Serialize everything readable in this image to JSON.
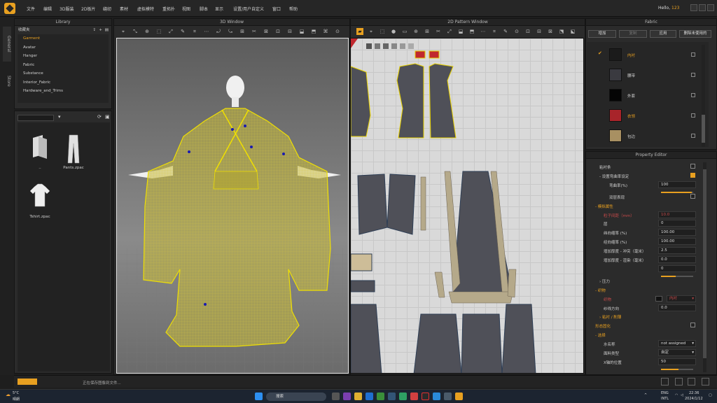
{
  "menu": [
    "文件",
    "编辑",
    "3D服装",
    "2D板片",
    "缝纫",
    "素材",
    "虚拟模特",
    "重拓扑",
    "视图",
    "脚本",
    "显示",
    "设置/用户自定义",
    "窗口",
    "帮助"
  ],
  "greeting": {
    "prefix": "Hello, ",
    "user": "123"
  },
  "side_tabs": [
    "General",
    "Store"
  ],
  "library": {
    "title": "Library",
    "favorites_label": "收藏夹",
    "items": [
      "Garment",
      "Avatar",
      "Hanger",
      "Fabric",
      "Substance",
      "Interior_Fabric",
      "Hardware_and_Trims"
    ],
    "selected_index": 0,
    "files": [
      {
        "label": ".."
      },
      {
        "label": "Pants.zpac"
      },
      {
        "label": "Tshirt.zpac"
      }
    ]
  },
  "window_3d": {
    "title": "3D Window"
  },
  "window_2d": {
    "title": "2D Pattern Window"
  },
  "fabric": {
    "title": "Fabric",
    "buttons": [
      "增加",
      "复制",
      "应用",
      "删除未使用的"
    ],
    "items": [
      {
        "name": "内衬",
        "color": "#1b1b1b",
        "highlight": true,
        "checked": true
      },
      {
        "name": "腰带",
        "color": "#3a3a40",
        "highlight": false,
        "checked": false
      },
      {
        "name": "外套",
        "color": "#050505",
        "highlight": false,
        "checked": false
      },
      {
        "name": "衣领",
        "color": "#a8242a",
        "highlight": true,
        "checked": false
      },
      {
        "name": "包边",
        "color": "#a89062",
        "highlight": false,
        "checked": false
      }
    ]
  },
  "property": {
    "title": "Property Editor",
    "rows": [
      {
        "label": "粘衬条",
        "type": "check",
        "checked": false,
        "indent": 8
      },
      {
        "label": "- 设置弯曲率设定",
        "type": "check",
        "checked": true,
        "indent": 8
      },
      {
        "label": "弯曲率(%)",
        "type": "value",
        "value": "100",
        "indent": 22,
        "slider": 0.95
      },
      {
        "label": "双层表现",
        "type": "check",
        "checked": false,
        "indent": 22
      },
      {
        "label": "- 模拟属性",
        "type": "section",
        "indent": 2
      },
      {
        "label": "粒子间距（mm）",
        "type": "value",
        "value": "10.0",
        "indent": 14,
        "style": "red",
        "valstyle": "red"
      },
      {
        "label": "层",
        "type": "value",
        "value": "0",
        "indent": 14
      },
      {
        "label": "纬向缩率 (%)",
        "type": "value",
        "value": "100.00",
        "indent": 14
      },
      {
        "label": "经向缩率 (%)",
        "type": "value",
        "value": "100.00",
        "indent": 14
      },
      {
        "label": "增加厚度 - 冲突（毫米）",
        "type": "value",
        "value": "2.5",
        "indent": 14
      },
      {
        "label": "增加厚度 - 渲染（毫米）",
        "type": "value",
        "value": "0.0",
        "indent": 14
      },
      {
        "label": "",
        "type": "value",
        "value": "0",
        "indent": 14,
        "slider": 0.45
      },
      {
        "label": "› 压力",
        "type": "plain",
        "indent": 8
      },
      {
        "label": "- 织物",
        "type": "section",
        "indent": 2
      },
      {
        "label": "织物",
        "type": "fabric",
        "value": "内衬",
        "indent": 14,
        "style": "red"
      },
      {
        "label": "纱线方向",
        "type": "value",
        "value": "0.0",
        "indent": 14
      },
      {
        "label": "› 粘衬 / 削薄",
        "type": "section",
        "indent": 8
      },
      {
        "label": "形态固化",
        "type": "check",
        "checked": false,
        "indent": 2,
        "style": "or"
      },
      {
        "label": "- 选择",
        "type": "section",
        "indent": 2
      },
      {
        "label": "水名称",
        "type": "select",
        "value": "not assigned",
        "indent": 14
      },
      {
        "label": "面料类型",
        "type": "select",
        "value": "自定",
        "indent": 14
      },
      {
        "label": "X轴的位置",
        "type": "value",
        "value": "50",
        "indent": 14,
        "slider": 0.55
      }
    ]
  },
  "status": {
    "message": "正在保存图像到文件...",
    "progress": 1.0
  },
  "taskbar": {
    "weather_temp": "5°C",
    "weather_desc": "晴朗",
    "search_placeholder": "搜索",
    "lang_top": "ENG",
    "lang_bottom": "INTL",
    "time": "22:36",
    "date": "2024/1/12"
  },
  "colors": {
    "accent": "#e8a020",
    "bg": "#2b2b2b",
    "garment": "#e6d000"
  }
}
